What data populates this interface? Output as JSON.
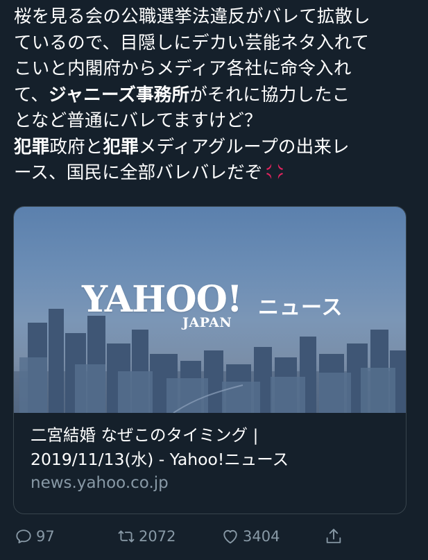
{
  "tweet": {
    "lines": [
      {
        "parts": [
          {
            "t": "桜を見る会の公職選挙法違反がバレて拡散し",
            "b": false
          }
        ]
      },
      {
        "parts": [
          {
            "t": "ているので、目隠しにデカい芸能ネタ入れて",
            "b": false
          }
        ]
      },
      {
        "parts": [
          {
            "t": "こいと内閣府からメディア各社に命令入れ",
            "b": false
          }
        ]
      },
      {
        "parts": [
          {
            "t": "て、",
            "b": false
          },
          {
            "t": "ジャニーズ事務所",
            "b": true
          },
          {
            "t": "がそれに協力したこ",
            "b": false
          }
        ]
      },
      {
        "parts": [
          {
            "t": "となど普通にバレてますけど？",
            "b": false
          }
        ]
      },
      {
        "parts": [
          {
            "t": "犯罪",
            "b": true
          },
          {
            "t": "政府と",
            "b": false
          },
          {
            "t": "犯罪",
            "b": true
          },
          {
            "t": "メディアグループの出来レ",
            "b": false
          }
        ]
      },
      {
        "parts": [
          {
            "t": "ース、国民に全部バレバレだぞ",
            "b": false
          }
        ],
        "emoji": "anger-symbol-icon"
      }
    ]
  },
  "card": {
    "logo_main": "YAHOO!",
    "logo_sub": "JAPAN",
    "logo_news": "ニュース",
    "title_line1": "二宮結婚 なぜこのタイミング |",
    "title_line2": "2019/11/13(水) - Yahoo!ニュース",
    "domain": "news.yahoo.co.jp"
  },
  "actions": {
    "reply_count": "97",
    "retweet_count": "2072",
    "like_count": "3404"
  },
  "colors": {
    "background": "#15202b",
    "secondary_text": "#8899a6",
    "border": "#38444d",
    "emoji_red": "#e0245e"
  },
  "icons": [
    "reply-icon",
    "retweet-icon",
    "like-icon",
    "share-icon",
    "anger-symbol-icon"
  ]
}
